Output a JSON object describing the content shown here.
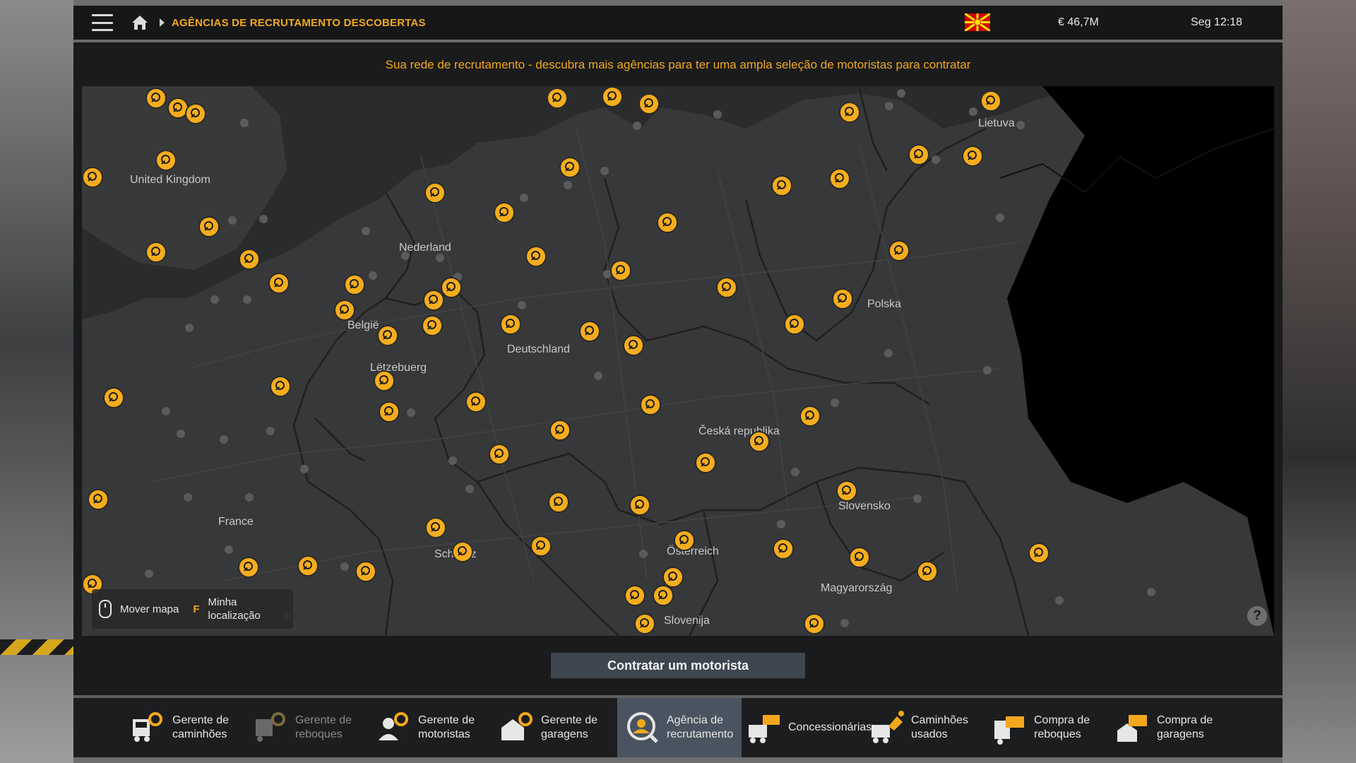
{
  "header": {
    "breadcrumb": "AGÊNCIAS DE RECRUTAMENTO DESCOBERTAS",
    "money": "€ 46,7M",
    "clock": "Seg 12:18"
  },
  "main": {
    "subtitle": "Sua rede de recrutamento - descubra mais agências para ter uma ampla seleção de motoristas para contratar",
    "hire_button": "Contratar um motorista"
  },
  "map": {
    "countries": [
      "United Kingdom",
      "Nederland",
      "België",
      "Lëtzebuerg",
      "Deutschland",
      "France",
      "Schweiz",
      "Österreich",
      "Česká republika",
      "Polska",
      "Lietuva",
      "Slovensko",
      "Magyarország",
      "Slovenija"
    ],
    "hints": {
      "move_map": "Mover mapa",
      "my_location_key": "F",
      "my_location": "Minha localização"
    },
    "help": "?"
  },
  "bottom_nav": [
    {
      "label": "Gerente de caminhões",
      "icon": "truck-manager-icon",
      "enabled": true,
      "active": false
    },
    {
      "label": "Gerente de reboques",
      "icon": "trailer-manager-icon",
      "enabled": false,
      "active": false
    },
    {
      "label": "Gerente de motoristas",
      "icon": "driver-manager-icon",
      "enabled": true,
      "active": false
    },
    {
      "label": "Gerente de garagens",
      "icon": "garage-manager-icon",
      "enabled": true,
      "active": false
    },
    {
      "label": "Agência de recrutamento",
      "icon": "recruitment-agency-icon",
      "enabled": true,
      "active": true
    },
    {
      "label": "Concessionárias",
      "icon": "dealer-icon",
      "enabled": true,
      "active": false
    },
    {
      "label": "Caminhões usados",
      "icon": "used-trucks-icon",
      "enabled": true,
      "active": false
    },
    {
      "label": "Compra de reboques",
      "icon": "buy-trailers-icon",
      "enabled": true,
      "active": false
    },
    {
      "label": "Compra de garagens",
      "icon": "buy-garages-icon",
      "enabled": true,
      "active": false
    }
  ],
  "colors": {
    "accent": "#f2a81d",
    "panel": "#1a1b1c",
    "map": "#353637",
    "active_tab": "#4a5460"
  }
}
